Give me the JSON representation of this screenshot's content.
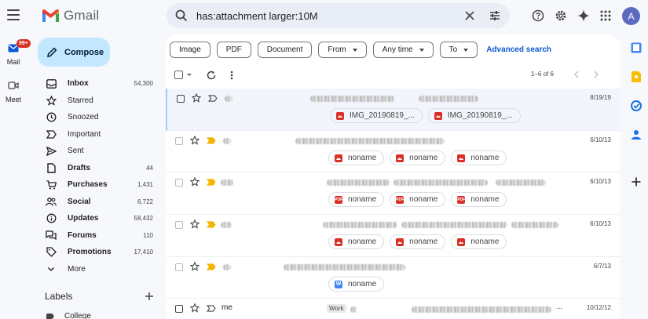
{
  "app": {
    "name": "Gmail"
  },
  "rail": {
    "mail": {
      "label": "Mail",
      "badge": "99+"
    },
    "meet": {
      "label": "Meet"
    }
  },
  "search": {
    "query": "has:attachment larger:10M"
  },
  "avatar": {
    "initial": "A"
  },
  "compose": {
    "label": "Compose"
  },
  "nav": [
    {
      "label": "Inbox",
      "count": "54,300",
      "bold": true,
      "icon": "inbox-icon"
    },
    {
      "label": "Starred",
      "count": "",
      "bold": false,
      "icon": "star-icon"
    },
    {
      "label": "Snoozed",
      "count": "",
      "bold": false,
      "icon": "clock-icon"
    },
    {
      "label": "Important",
      "count": "",
      "bold": false,
      "icon": "important-icon"
    },
    {
      "label": "Sent",
      "count": "",
      "bold": false,
      "icon": "send-icon"
    },
    {
      "label": "Drafts",
      "count": "44",
      "bold": true,
      "icon": "draft-icon"
    },
    {
      "label": "Purchases",
      "count": "1,431",
      "bold": true,
      "icon": "cart-icon"
    },
    {
      "label": "Social",
      "count": "6,722",
      "bold": true,
      "icon": "people-icon"
    },
    {
      "label": "Updates",
      "count": "58,432",
      "bold": true,
      "icon": "info-icon"
    },
    {
      "label": "Forums",
      "count": "110",
      "bold": true,
      "icon": "forum-icon"
    },
    {
      "label": "Promotions",
      "count": "17,410",
      "bold": true,
      "icon": "tag-icon"
    },
    {
      "label": "More",
      "count": "",
      "bold": false,
      "icon": "chevron-down-icon"
    }
  ],
  "labels": {
    "heading": "Labels",
    "items": [
      {
        "label": "College"
      }
    ]
  },
  "filters": {
    "chips": [
      "Image",
      "PDF",
      "Document"
    ],
    "dropdowns": [
      "From",
      "Any time",
      "To"
    ],
    "advanced": "Advanced search"
  },
  "pager": {
    "text": "1–6 of 6"
  },
  "emails": [
    {
      "date": "8/19/19",
      "sender": "",
      "attachments": [
        {
          "type": "img",
          "name": "IMG_20190819_..."
        },
        {
          "type": "img",
          "name": "IMG_20190819_..."
        }
      ]
    },
    {
      "date": "6/10/13",
      "sender": "",
      "attachments": [
        {
          "type": "img",
          "name": "noname"
        },
        {
          "type": "img",
          "name": "noname"
        },
        {
          "type": "img",
          "name": "noname"
        }
      ]
    },
    {
      "date": "6/10/13",
      "sender": "",
      "attachments": [
        {
          "type": "pdf",
          "name": "noname"
        },
        {
          "type": "pdf",
          "name": "noname"
        },
        {
          "type": "pdf",
          "name": "noname"
        }
      ]
    },
    {
      "date": "6/10/13",
      "sender": "",
      "attachments": [
        {
          "type": "img",
          "name": "noname"
        },
        {
          "type": "img",
          "name": "noname"
        },
        {
          "type": "img",
          "name": "noname"
        }
      ]
    },
    {
      "date": "6/7/13",
      "sender": "",
      "attachments": [
        {
          "type": "doc",
          "name": "noname"
        }
      ]
    },
    {
      "date": "10/12/12",
      "sender": "me",
      "tag": "Work",
      "ellipsis": "...",
      "attachments": []
    }
  ]
}
